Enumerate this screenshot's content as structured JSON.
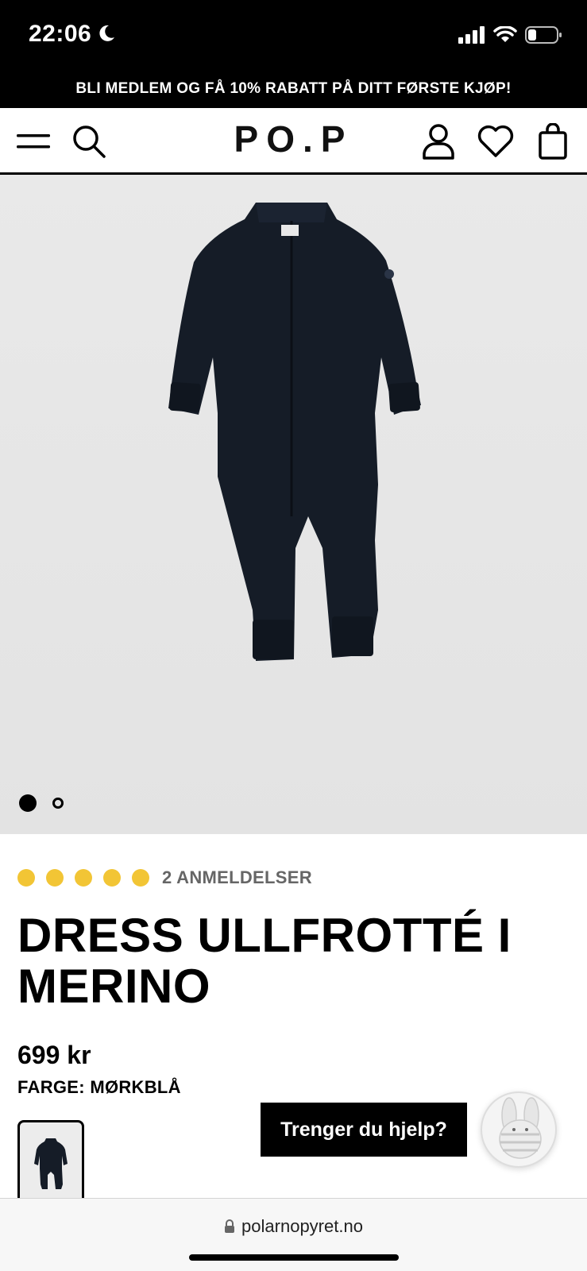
{
  "status_bar": {
    "time": "22:06",
    "icons": [
      "moon-icon",
      "signal-icon",
      "wifi-icon",
      "battery-icon"
    ]
  },
  "promo": {
    "text": "BLI MEDLEM OG FÅ 10% RABATT PÅ DITT FØRSTE KJØP!"
  },
  "header": {
    "logo": "PO.P",
    "icons": [
      "menu-icon",
      "search-icon",
      "account-icon",
      "wishlist-icon",
      "bag-icon"
    ]
  },
  "gallery": {
    "image_count": 2,
    "active_index": 0
  },
  "product": {
    "rating": 5,
    "rating_max": 5,
    "reviews_label": "2 ANMELDELSER",
    "title": "DRESS ULLFROTTÉ I MERINO",
    "price": "699 kr",
    "color_label": "FARGE: MØRKBLÅ"
  },
  "help": {
    "label": "Trenger du hjelp?"
  },
  "browser": {
    "url": "polarnopyret.no"
  },
  "colors": {
    "rating_dot": "#f2c535",
    "garment": "#151c27",
    "background_gray": "#e6e6e6"
  }
}
